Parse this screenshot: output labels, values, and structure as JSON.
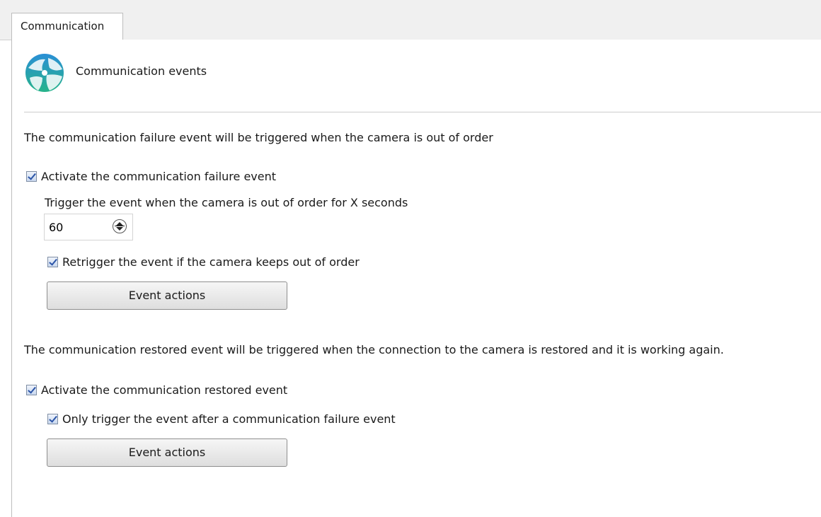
{
  "tabs": [
    {
      "label": "Communication"
    }
  ],
  "header": {
    "title": "Communication events",
    "icon": "communication-globe-icon"
  },
  "failure": {
    "description": "The communication failure event will be triggered when the camera is out of order",
    "activate_label": "Activate the communication failure event",
    "activate_checked": true,
    "trigger_label": "Trigger the event when the camera is out of order for X seconds",
    "seconds_value": "60",
    "retrigger_label": "Retrigger the event if the camera keeps out of order",
    "retrigger_checked": true,
    "actions_label": "Event actions"
  },
  "restored": {
    "description": "The communication restored event will be triggered when the connection to the camera is restored and it is working again.",
    "activate_label": "Activate the communication restored event",
    "activate_checked": true,
    "only_after_label": "Only trigger the event after a communication failure event",
    "only_after_checked": true,
    "actions_label": "Event actions"
  },
  "colors": {
    "checkmark": "#2c55a8",
    "icon_blue": "#2a8fd6",
    "icon_green": "#27b38a"
  }
}
